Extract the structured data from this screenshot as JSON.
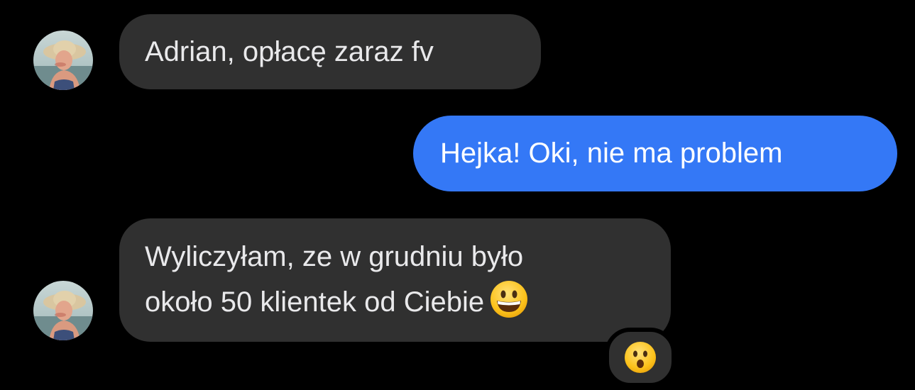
{
  "conversation": {
    "messages": [
      {
        "sender": "incoming",
        "lines": [
          "Adrian, opłacę zaraz fv"
        ]
      },
      {
        "sender": "outgoing",
        "lines": [
          "Hejka! Oki, nie ma problem"
        ]
      },
      {
        "sender": "incoming",
        "lines": [
          "Wyliczyłam, ze w grudniu było",
          "około 50 klientek od Ciebie"
        ],
        "inline_emoji": "grinning-face",
        "reaction": "hushed-face"
      }
    ]
  },
  "colors": {
    "background": "#000000",
    "incoming_bubble": "#303030",
    "outgoing_bubble": "#3478f6",
    "text": "#e9e9eb"
  }
}
